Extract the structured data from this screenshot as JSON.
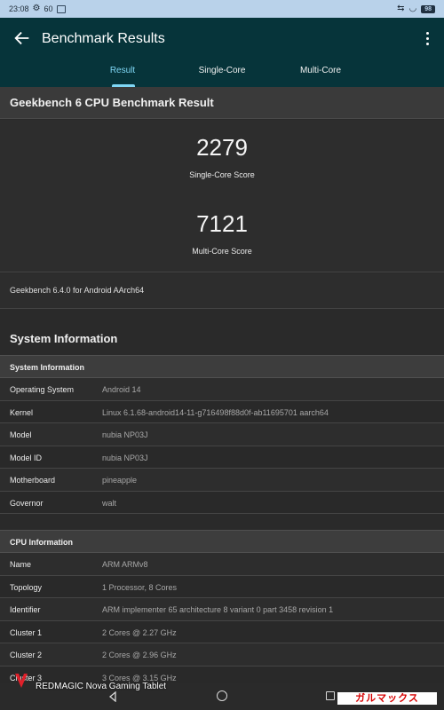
{
  "status_bar": {
    "time": "23:08",
    "refresh": "60",
    "battery": "98"
  },
  "app_bar": {
    "title": "Benchmark Results"
  },
  "tabs": [
    {
      "label": "Result",
      "active": true
    },
    {
      "label": "Single-Core",
      "active": false
    },
    {
      "label": "Multi-Core",
      "active": false
    }
  ],
  "result": {
    "title": "Geekbench 6 CPU Benchmark Result",
    "single_core_score": "2279",
    "single_core_label": "Single-Core Score",
    "multi_core_score": "7121",
    "multi_core_label": "Multi-Core Score",
    "version": "Geekbench 6.4.0 for Android AArch64"
  },
  "system_information": {
    "section_title": "System Information",
    "table_title": "System Information",
    "rows": [
      {
        "key": "Operating System",
        "value": "Android 14"
      },
      {
        "key": "Kernel",
        "value": "Linux 6.1.68-android14-11-g716498f88d0f-ab11695701 aarch64"
      },
      {
        "key": "Model",
        "value": "nubia NP03J"
      },
      {
        "key": "Model ID",
        "value": "nubia NP03J"
      },
      {
        "key": "Motherboard",
        "value": "pineapple"
      },
      {
        "key": "Governor",
        "value": "walt"
      }
    ]
  },
  "cpu_information": {
    "table_title": "CPU Information",
    "rows": [
      {
        "key": "Name",
        "value": "ARM ARMv8"
      },
      {
        "key": "Topology",
        "value": "1 Processor, 8 Cores"
      },
      {
        "key": "Identifier",
        "value": "ARM implementer 65 architecture 8 variant 0 part 3458 revision 1"
      },
      {
        "key": "Cluster 1",
        "value": "2 Cores @ 2.27 GHz"
      },
      {
        "key": "Cluster 2",
        "value": "2 Cores @ 2.96 GHz"
      },
      {
        "key": "Cluster 3",
        "value": "3 Cores @ 3.15 GHz"
      }
    ]
  },
  "watermark": {
    "device": "REDMAGIC Nova Gaming Tablet",
    "brand": "ガルマックス"
  },
  "colors": {
    "app_bar": "#06343a",
    "accent": "#7fd7f5",
    "status_bar": "#b9d2ea",
    "background": "#2a2a2a"
  }
}
